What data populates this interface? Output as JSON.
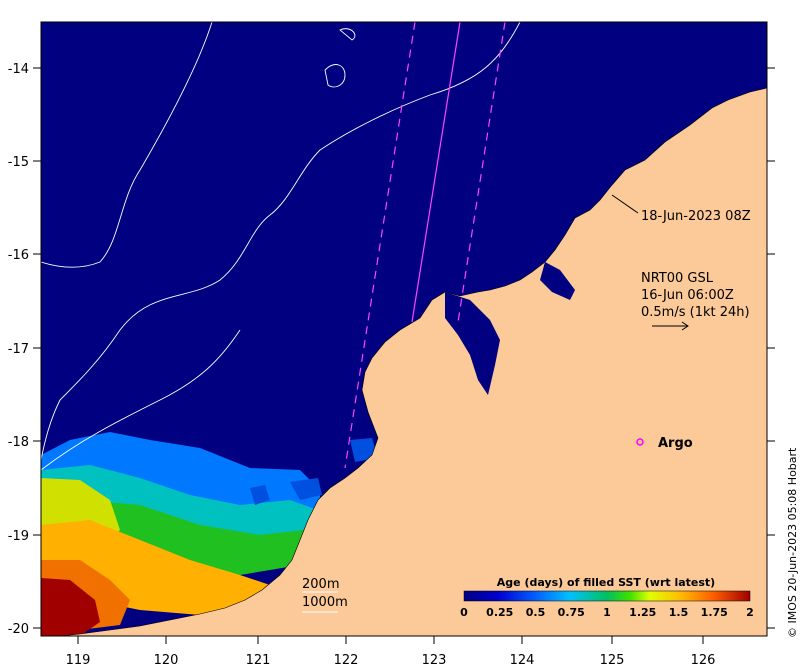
{
  "map": {
    "lon_ticks": [
      "119",
      "120",
      "121",
      "122",
      "123",
      "124",
      "125",
      "126"
    ],
    "lat_ticks": [
      "-14",
      "-15",
      "-16",
      "-17",
      "-18",
      "-19",
      "-20"
    ],
    "colors": {
      "land": "#fcc998",
      "ocean_latest": "#000080",
      "contour": "#ffffff",
      "track": "#ff44ff"
    }
  },
  "annotations": {
    "satellite_pass": "18-Jun-2023 08Z",
    "currents_line1": "NRT00 GSL",
    "currents_line2": "16-Jun 06:00Z",
    "currents_line3": "0.5m/s (1kt 24h)",
    "argo_label": "Argo",
    "contour_200": "200m",
    "contour_1000": "1000m"
  },
  "colorbar": {
    "title": "Age (days) of filled SST (wrt latest)",
    "ticks": [
      "0",
      "0.25",
      "0.5",
      "0.75",
      "1",
      "1.25",
      "1.5",
      "1.75",
      "2"
    ],
    "range": [
      0,
      2
    ]
  },
  "credit": "© IMOS 20-Jun-2023 05:08 Hobart"
}
